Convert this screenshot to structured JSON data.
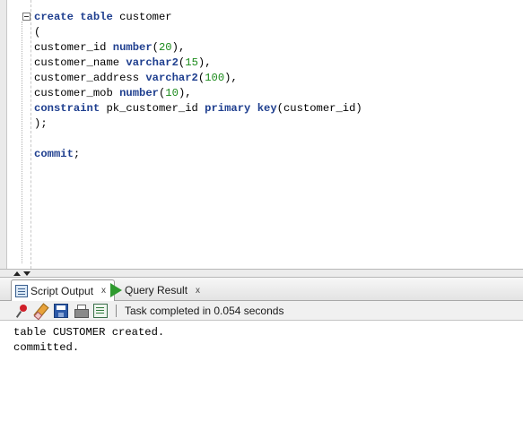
{
  "editor": {
    "lines": [
      [
        {
          "t": "create",
          "k": "kw"
        },
        {
          "t": " "
        },
        {
          "t": "table",
          "k": "kw"
        },
        {
          "t": " customer"
        }
      ],
      [
        {
          "t": "("
        }
      ],
      [
        {
          "t": "customer_id "
        },
        {
          "t": "number",
          "k": "kw"
        },
        {
          "t": "("
        },
        {
          "t": "20",
          "k": "num"
        },
        {
          "t": "),"
        }
      ],
      [
        {
          "t": "customer_name "
        },
        {
          "t": "varchar2",
          "k": "kw"
        },
        {
          "t": "("
        },
        {
          "t": "15",
          "k": "num"
        },
        {
          "t": "),"
        }
      ],
      [
        {
          "t": "customer_address "
        },
        {
          "t": "varchar2",
          "k": "kw"
        },
        {
          "t": "("
        },
        {
          "t": "100",
          "k": "num"
        },
        {
          "t": "),"
        }
      ],
      [
        {
          "t": "customer_mob "
        },
        {
          "t": "number",
          "k": "kw"
        },
        {
          "t": "("
        },
        {
          "t": "10",
          "k": "num"
        },
        {
          "t": "),"
        }
      ],
      [
        {
          "t": "constraint",
          "k": "kw"
        },
        {
          "t": " pk_customer_id "
        },
        {
          "t": "primary",
          "k": "kw"
        },
        {
          "t": " "
        },
        {
          "t": "key",
          "k": "kw"
        },
        {
          "t": "(customer_id)"
        }
      ],
      [
        {
          "t": ");"
        }
      ],
      [],
      [
        {
          "t": "commit",
          "k": "kw"
        },
        {
          "t": ";"
        }
      ]
    ]
  },
  "tabs": [
    {
      "label": "Script Output",
      "close": "x",
      "icon": "script-output-icon"
    },
    {
      "label": "Query Result",
      "close": "x",
      "icon": "run-query-icon"
    }
  ],
  "toolbar": {
    "icons": [
      "pin-icon",
      "eraser-icon",
      "save-icon",
      "print-icon",
      "document-icon"
    ],
    "status": "Task completed in 0.054 seconds"
  },
  "output": {
    "lines": [
      "table CUSTOMER created.",
      "committed."
    ]
  },
  "colors": {
    "keyword": "#1f3f8f",
    "number_literal": "#1a8a1a",
    "active_tab": "#ffffff"
  }
}
